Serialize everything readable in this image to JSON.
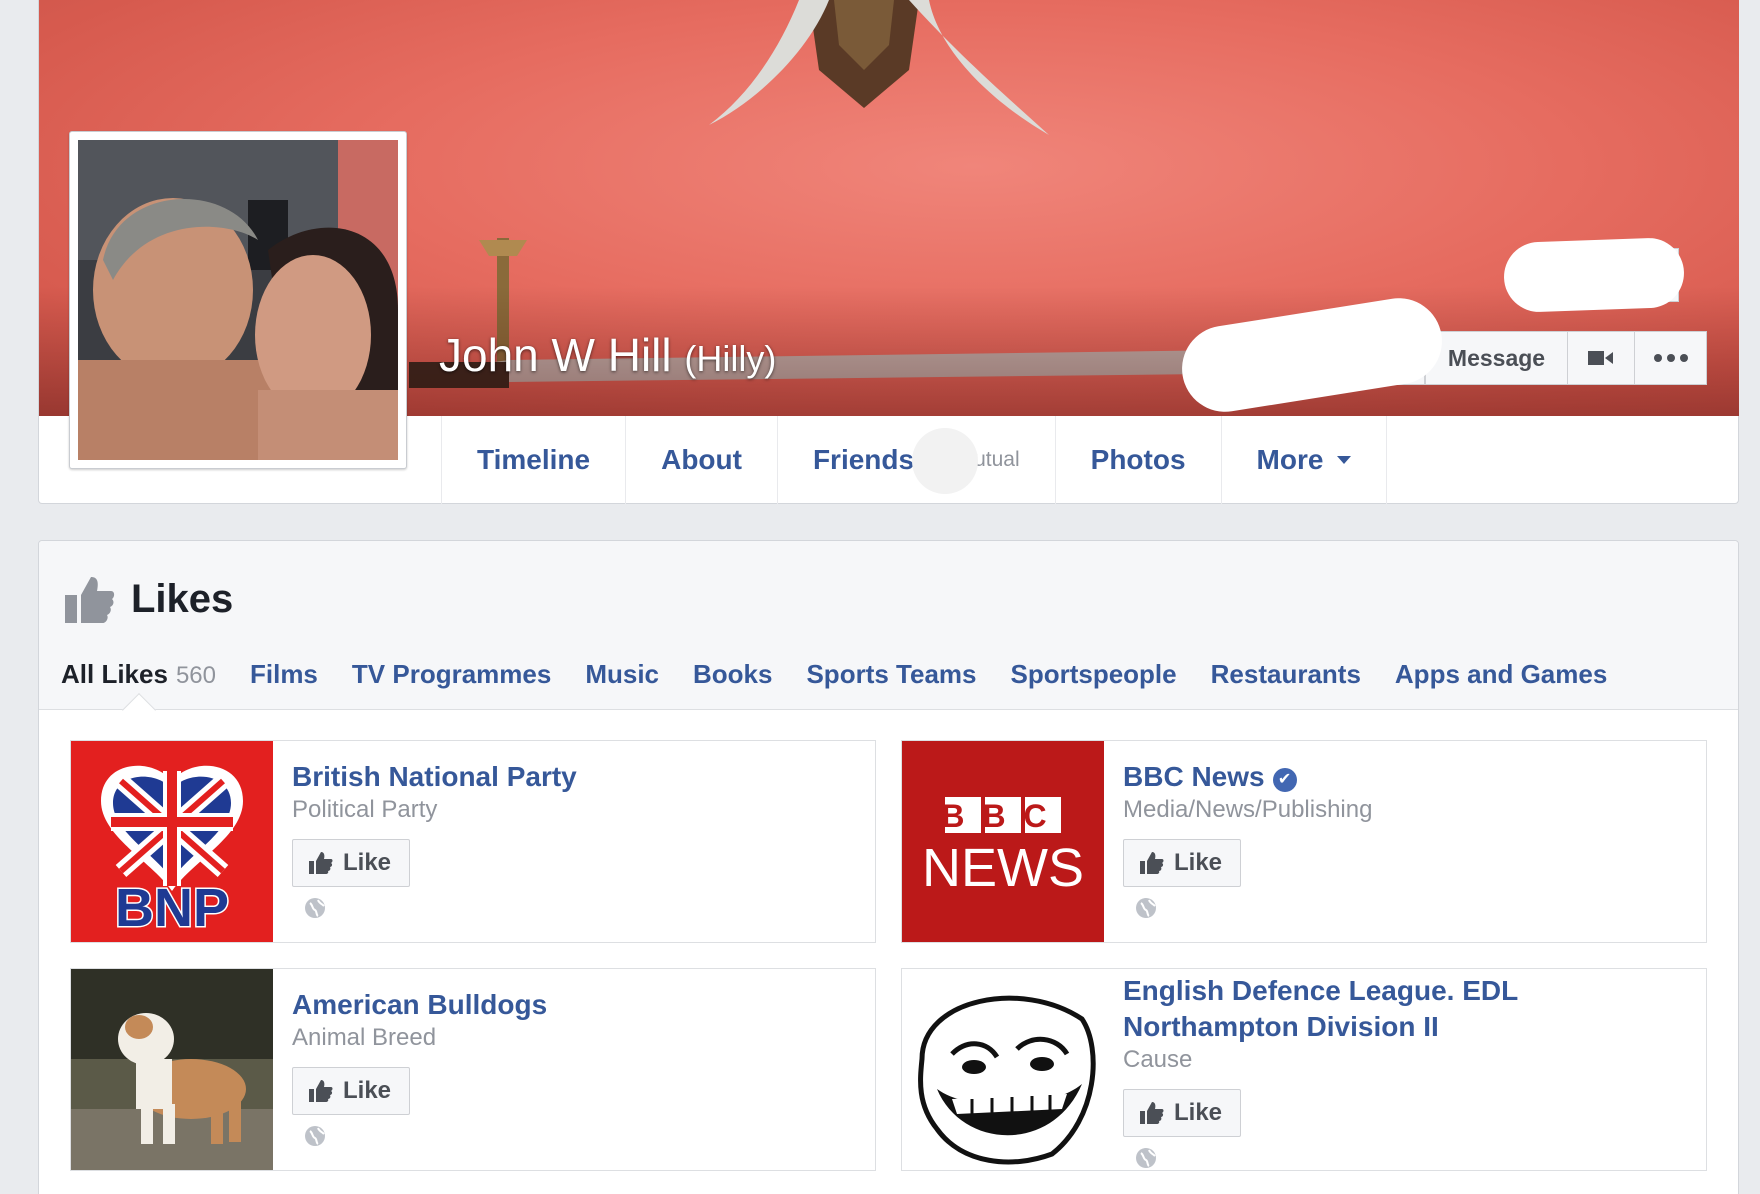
{
  "profile": {
    "name": "John W Hill",
    "alternate_name": "(Hilly)"
  },
  "cover_actions": {
    "message": "Message"
  },
  "tabs": [
    {
      "label": "Timeline"
    },
    {
      "label": "About"
    },
    {
      "label": "Friends",
      "sub": "utual"
    },
    {
      "label": "Photos"
    },
    {
      "label": "More"
    }
  ],
  "likes": {
    "title": "Likes",
    "subtabs": [
      {
        "label": "All Likes",
        "count": "560",
        "active": true
      },
      {
        "label": "Films"
      },
      {
        "label": "TV Programmes"
      },
      {
        "label": "Music"
      },
      {
        "label": "Books"
      },
      {
        "label": "Sports Teams"
      },
      {
        "label": "Sportspeople"
      },
      {
        "label": "Restaurants"
      },
      {
        "label": "Apps and Games"
      }
    ],
    "items": [
      {
        "title": "British National Party",
        "category": "Political Party",
        "button": "Like",
        "logo_text": "BNP"
      },
      {
        "title": "BBC News",
        "category": "Media/News/Publishing",
        "button": "Like",
        "verified": true,
        "logo_line1": "BBC",
        "logo_line2": "NEWS"
      },
      {
        "title": "American Bulldogs",
        "category": "Animal Breed",
        "button": "Like"
      },
      {
        "title": "English Defence League. EDL Northampton Division II",
        "category": "Cause",
        "button": "Like"
      }
    ]
  },
  "colors": {
    "link_blue": "#365899",
    "cover_red": "#e66c60",
    "bnp_red": "#e3201f",
    "bbc_red": "#bb1919",
    "page_bg": "#e9ebee"
  },
  "icons": [
    "thumbs-up-icon",
    "globe-icon",
    "video-camera-icon",
    "more-dots-icon",
    "verified-badge-icon",
    "dropdown-caret-icon"
  ]
}
